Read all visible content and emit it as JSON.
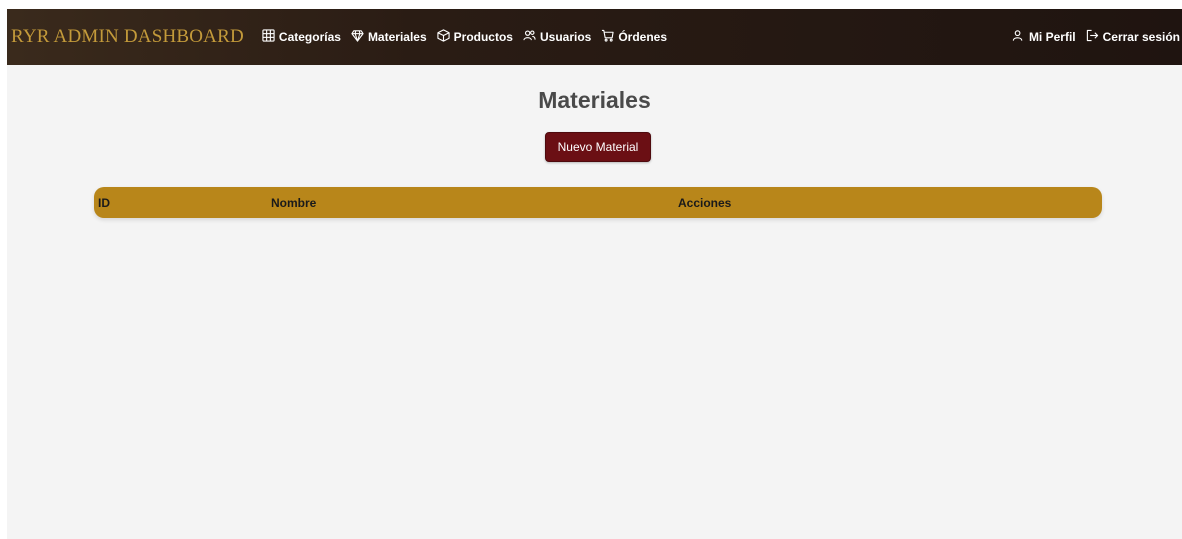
{
  "navbar": {
    "brand": "RYR ADMIN DASHBOARD",
    "links": [
      {
        "label": "Categorías",
        "icon": "grid-icon"
      },
      {
        "label": "Materiales",
        "icon": "gem-icon"
      },
      {
        "label": "Productos",
        "icon": "box-icon"
      },
      {
        "label": "Usuarios",
        "icon": "users-icon"
      },
      {
        "label": "Órdenes",
        "icon": "cart-icon"
      }
    ],
    "right_links": [
      {
        "label": "Mi Perfil",
        "icon": "user-icon"
      },
      {
        "label": "Cerrar sesión",
        "icon": "logout-icon"
      }
    ]
  },
  "main": {
    "title": "Materiales",
    "new_button_label": "Nuevo Material",
    "table": {
      "columns": [
        "ID",
        "Nombre",
        "Acciones"
      ],
      "rows": []
    }
  },
  "colors": {
    "navbar_bg": "#2a1c14",
    "brand": "#c39a3a",
    "button_bg": "#6b0f14",
    "table_header_bg": "#b8861a",
    "page_bg": "#f4f4f4"
  }
}
